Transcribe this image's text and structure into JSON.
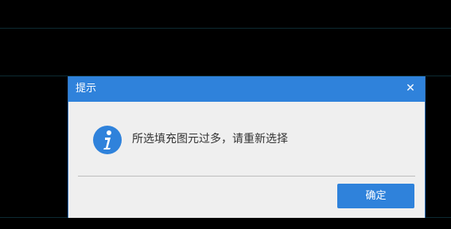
{
  "dialog": {
    "title": "提示",
    "close_glyph": "✕",
    "icon": "info-icon",
    "message": "所选填充图元过多，请重新选择",
    "ok_label": "确定"
  },
  "colors": {
    "titlebar": "#2f82db",
    "button": "#2f82db",
    "dialog_bg": "#efefef",
    "backdrop": "#000000"
  }
}
